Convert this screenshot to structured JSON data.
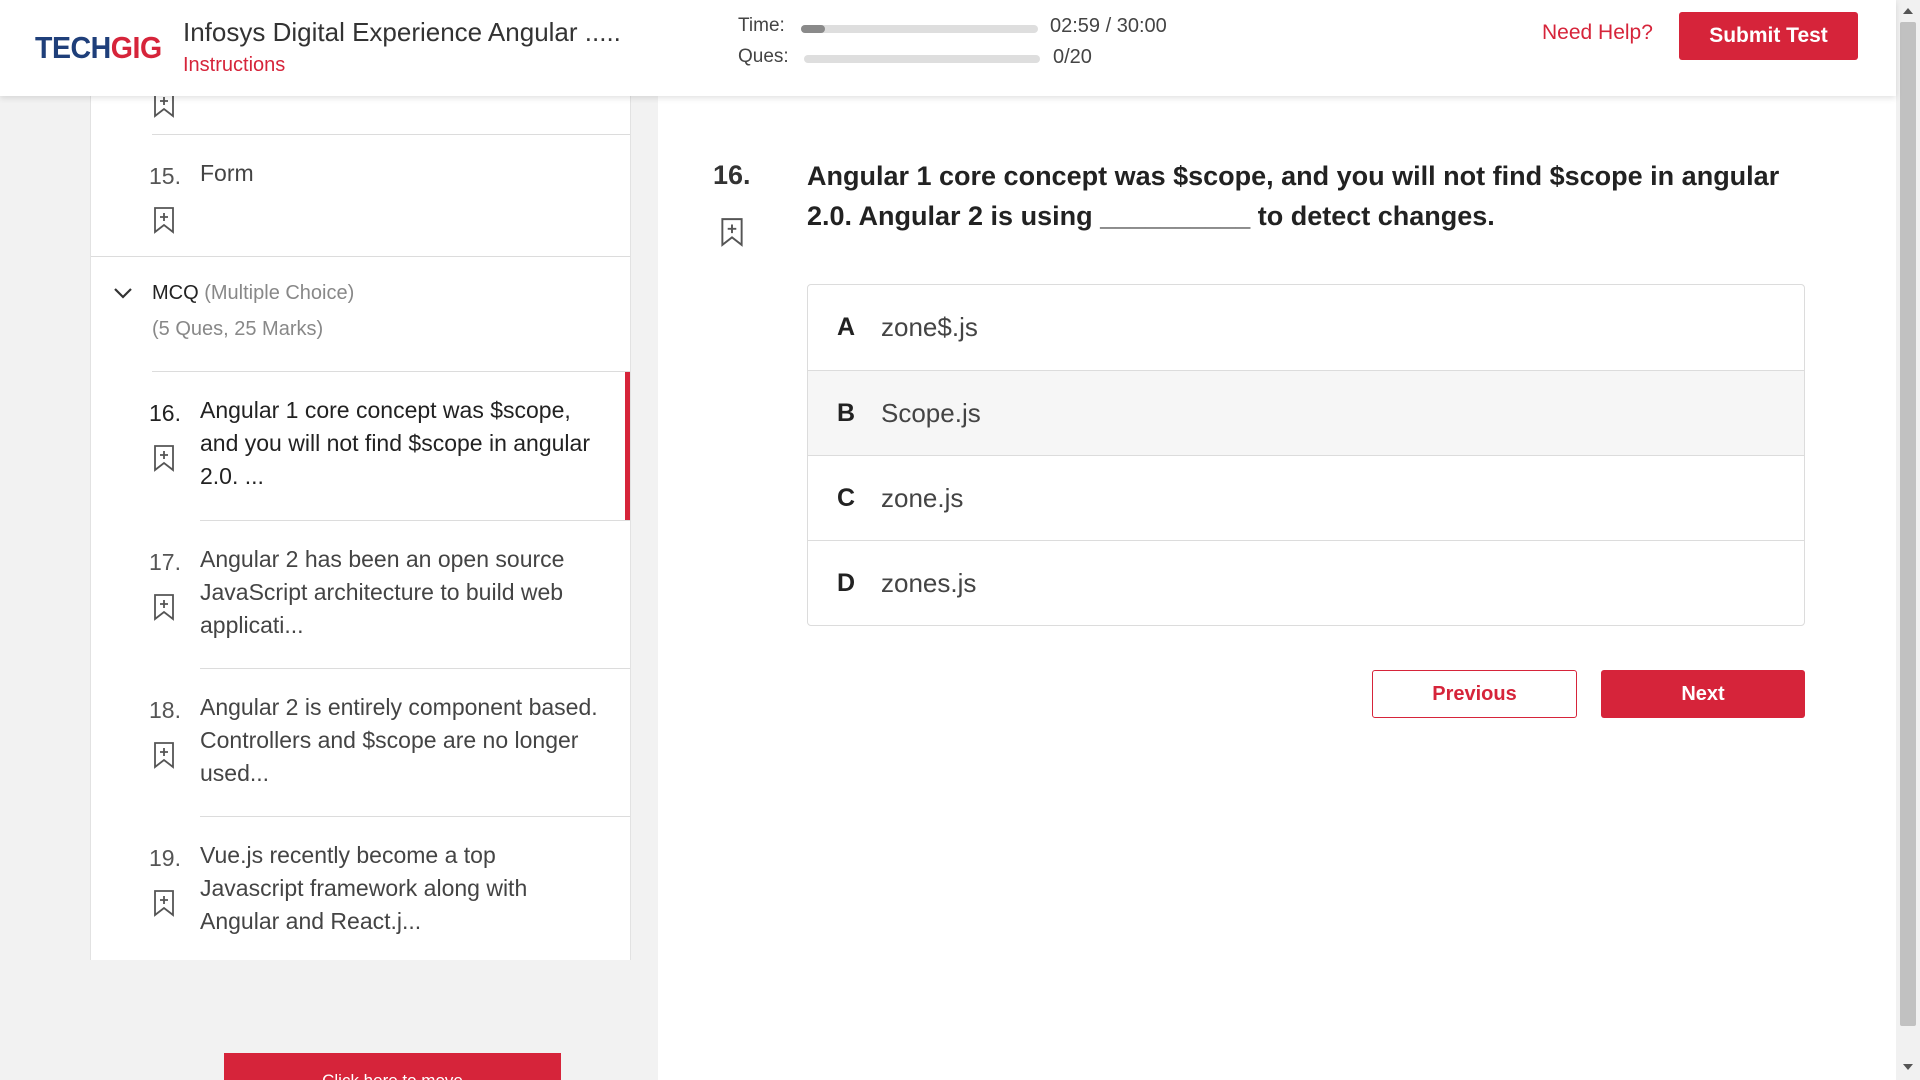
{
  "header": {
    "logo_part1": "TECH",
    "logo_part2": "GIG",
    "test_title": "Infosys Digital Experience Angular .....",
    "instructions_link": "Instructions",
    "time_label": "Time:",
    "time_value": "02:59 / 30:00",
    "time_progress": 0.1,
    "ques_label": "Ques:",
    "ques_value": "0/20",
    "ques_progress": 0,
    "need_help": "Need Help?",
    "submit_label": "Submit Test"
  },
  "sidebar": {
    "questions_before": [
      {
        "num": "15.",
        "text": "Form"
      }
    ],
    "section": {
      "name": "MCQ",
      "type": "(Multiple Choice)",
      "marks": "(5 Ques, 25 Marks)"
    },
    "questions": [
      {
        "num": "16.",
        "text": "Angular 1 core concept was $scope, and you will not find $scope in angular 2.0. ..."
      },
      {
        "num": "17.",
        "text": "Angular 2 has been an open source JavaScript architecture to build web applicati..."
      },
      {
        "num": "18.",
        "text": "Angular 2 is entirely component based. Controllers and $scope are no longer used..."
      },
      {
        "num": "19.",
        "text": "Vue.js recently become a top Javascript framework along with Angular and React.j..."
      }
    ],
    "move_button": "Click here to move"
  },
  "main": {
    "question_num": "16.",
    "question_text": "Angular 1 core concept was $scope, and you will not find $scope in angular 2.0. Angular 2 is using __________ to detect changes.",
    "options": [
      {
        "letter": "A",
        "text": "zone$.js"
      },
      {
        "letter": "B",
        "text": "Scope.js"
      },
      {
        "letter": "C",
        "text": "zone.js"
      },
      {
        "letter": "D",
        "text": "zones.js"
      }
    ],
    "previous_label": "Previous",
    "next_label": "Next"
  },
  "colors": {
    "accent": "#d6243a",
    "logo_blue": "#1f3f7a"
  }
}
